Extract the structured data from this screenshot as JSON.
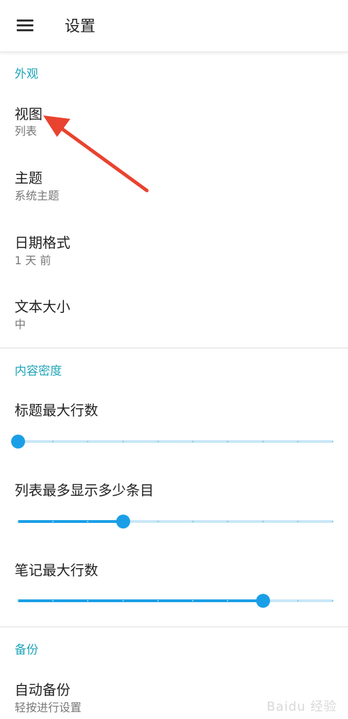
{
  "header": {
    "title": "设置",
    "menu_icon": "hamburger-menu-icon"
  },
  "sections": {
    "appearance": {
      "header": "外观",
      "items": [
        {
          "title": "视图",
          "summary": "列表"
        },
        {
          "title": "主题",
          "summary": "系统主题"
        },
        {
          "title": "日期格式",
          "summary": "1 天 前"
        },
        {
          "title": "文本大小",
          "summary": "中"
        }
      ]
    },
    "density": {
      "header": "内容密度",
      "sliders": [
        {
          "title": "标题最大行数",
          "level_fraction": 0.0,
          "steps": 9
        },
        {
          "title": "列表最多显示多少条目",
          "level_fraction": 0.333,
          "steps": 9
        },
        {
          "title": "笔记最大行数",
          "level_fraction": 0.778,
          "steps": 9
        }
      ]
    },
    "backup": {
      "header": "备份",
      "items": [
        {
          "title": "自动备份",
          "summary": "轻按进行设置"
        }
      ]
    }
  },
  "colors": {
    "accent": "#1ea5b8",
    "slider_active": "#1a9fe6",
    "slider_inactive": "#c9e7f7",
    "annotation_arrow": "#e8432f"
  },
  "watermark": "Baidu 经验"
}
